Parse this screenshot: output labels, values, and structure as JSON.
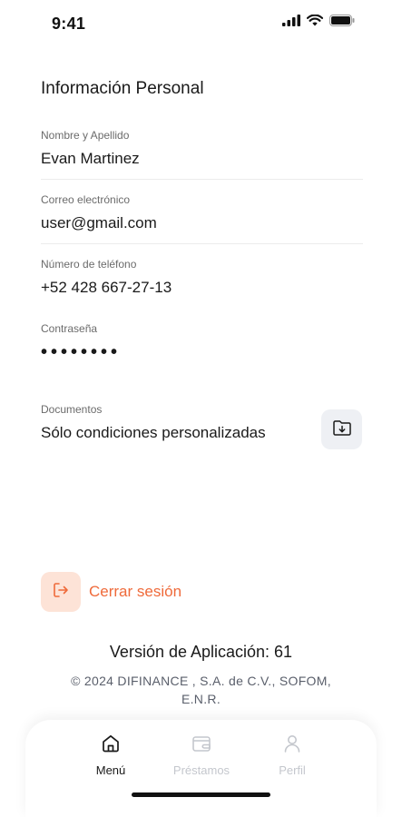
{
  "status_bar": {
    "time": "9:41"
  },
  "personal_info": {
    "title": "Información Personal",
    "fields": [
      {
        "label": "Nombre y Apellido",
        "value": "Evan Martinez"
      },
      {
        "label": "Correo electrónico",
        "value": "user@gmail.com"
      },
      {
        "label": "Número de teléfono",
        "value": "+52 428 667-27-13"
      },
      {
        "label": "Contraseña",
        "value": "••••••••"
      }
    ]
  },
  "documents": {
    "label": "Documentos",
    "value": "Sólo condiciones personalizadas",
    "action_icon": "folder-download-icon"
  },
  "logout": {
    "label": "Cerrar sesión",
    "icon": "logout-icon"
  },
  "footer": {
    "app_version": "Versión de Aplicación: 61",
    "copyright": "© 2024 DIFINANCE , S.A. de C.V., SOFOM, E.N.R."
  },
  "bottom_nav": {
    "items": [
      {
        "label": "Menú",
        "icon": "home-icon",
        "active": true
      },
      {
        "label": "Préstamos",
        "icon": "wallet-icon",
        "active": false
      },
      {
        "label": "Perfil",
        "icon": "user-icon",
        "active": false
      }
    ]
  },
  "colors": {
    "accent": "#ef6a3a",
    "accent_bg": "#fde3d7",
    "nav_inactive": "#c4c7cd",
    "label": "#6b6b6b"
  }
}
